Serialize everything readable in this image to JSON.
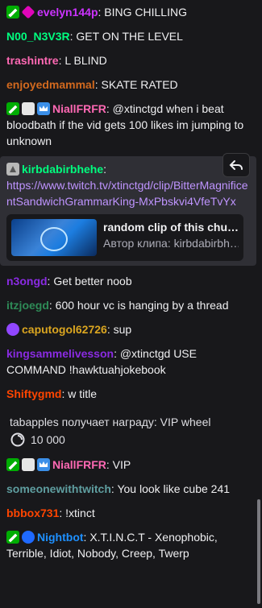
{
  "messages": [
    {
      "user": "evelyn144p",
      "color": "#cc33ff",
      "badges": [
        "mod",
        "vip"
      ],
      "text": "BING CHILLING"
    },
    {
      "user": "N00_N3V3R",
      "color": "#00ff7f",
      "badges": [],
      "text": "GET ON THE LEVEL"
    },
    {
      "user": "trashintre",
      "color": "#ff69b4",
      "badges": [],
      "text": "L BLIND"
    },
    {
      "user": "enjoyedmammal",
      "color": "#d2691e",
      "badges": [],
      "text": "SKATE RATED"
    },
    {
      "user": "NiallFRFR",
      "color": "#ff69b4",
      "badges": [
        "mod",
        "sub2",
        "crown"
      ],
      "text": "@xtinctgd when i beat bloodbath if the vid gets 100 likes im jumping to unknown"
    }
  ],
  "reply_card": {
    "user": "kirbdabirbhehe",
    "color": "#00ff7f",
    "badge": "gray",
    "link": "https://www.twitch.tv/xtinctgd/clip/BitterMagnificentSandwichGrammarKing-MxPbskvi4VfeTvYx",
    "clip_title": "random clip of this chud ju...",
    "clip_author": "Автор клипа: kirbdabirbhehe"
  },
  "messages2": [
    {
      "user": "n3ongd",
      "color": "#8a2be2",
      "badges": [],
      "text": "Get better noob"
    },
    {
      "user": "itzjoegd",
      "color": "#2e8b57",
      "badges": [],
      "text": "600 hour vc is hanging by a thread"
    },
    {
      "user": "caputogol62726",
      "color": "#daa520",
      "badges": [
        "bits"
      ],
      "text": "sup"
    },
    {
      "user": "kingsammelivesson",
      "color": "#8a2be2",
      "badges": [],
      "text": "@xtinctgd USE COMMAND !hawktuahjokebook"
    },
    {
      "user": "Shiftygmd",
      "color": "#ff4500",
      "badges": [],
      "text": "w title"
    }
  ],
  "reward": {
    "text": "tabapples получает награду: VIP wheel",
    "cost": "10 000"
  },
  "messages3": [
    {
      "user": "NiallFRFR",
      "color": "#ff69b4",
      "badges": [
        "mod",
        "sub2",
        "crown"
      ],
      "text": "VIP"
    },
    {
      "user": "someonewithtwitch",
      "color": "#5f9ea0",
      "badges": [],
      "text": "You look like cube 241"
    },
    {
      "user": "bbbox731",
      "color": "#ff4500",
      "badges": [],
      "text": "!xtinct"
    },
    {
      "user": "Nightbot",
      "color": "#1e90ff",
      "badges": [
        "mod",
        "bot"
      ],
      "text": "X.T.I.N.C.T - Xenophobic, Terrible, Idiot, Nobody, Creep, Twerp"
    }
  ]
}
